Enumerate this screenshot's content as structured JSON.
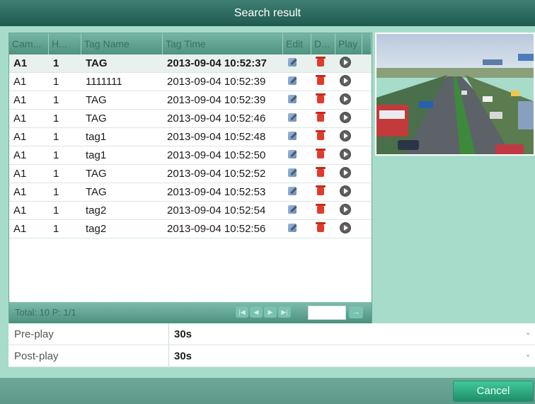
{
  "window": {
    "title": "Search result"
  },
  "table": {
    "headers": [
      "Cam...",
      "H...",
      "Tag Name",
      "Tag Time",
      "Edit",
      "D...",
      "Play"
    ],
    "rows": [
      [
        "A1",
        "1",
        "TAG",
        "2013-09-04 10:52:37"
      ],
      [
        "A1",
        "1",
        "1111111",
        "2013-09-04 10:52:39"
      ],
      [
        "A1",
        "1",
        "TAG",
        "2013-09-04 10:52:39"
      ],
      [
        "A1",
        "1",
        "TAG",
        "2013-09-04 10:52:46"
      ],
      [
        "A1",
        "1",
        "tag1",
        "2013-09-04 10:52:48"
      ],
      [
        "A1",
        "1",
        "tag1",
        "2013-09-04 10:52:50"
      ],
      [
        "A1",
        "1",
        "TAG",
        "2013-09-04 10:52:52"
      ],
      [
        "A1",
        "1",
        "TAG",
        "2013-09-04 10:52:53"
      ],
      [
        "A1",
        "1",
        "tag2",
        "2013-09-04 10:52:54"
      ],
      [
        "A1",
        "1",
        "tag2",
        "2013-09-04 10:52:56"
      ]
    ],
    "row_icons": {
      "edit": "edit-icon",
      "delete": "delete-icon",
      "play": "play-icon"
    },
    "selected_row": 0
  },
  "pager": {
    "total_label": "Total: 10  P: 1/1",
    "buttons": [
      "first-page-icon",
      "prev-page-icon",
      "next-page-icon",
      "last-page-icon"
    ],
    "go_icon": "arrow-right-icon"
  },
  "settings": {
    "pre_play": {
      "label": "Pre-play",
      "value": "30s"
    },
    "post_play": {
      "label": "Post-play",
      "value": "30s"
    }
  },
  "buttons": {
    "cancel": "Cancel"
  },
  "colors": {
    "background": "#a7dccb",
    "titlebar": "#2f6c61",
    "header": "#5fa391",
    "accent_button": "#2aa77d",
    "delete_red": "#e23a2b"
  }
}
